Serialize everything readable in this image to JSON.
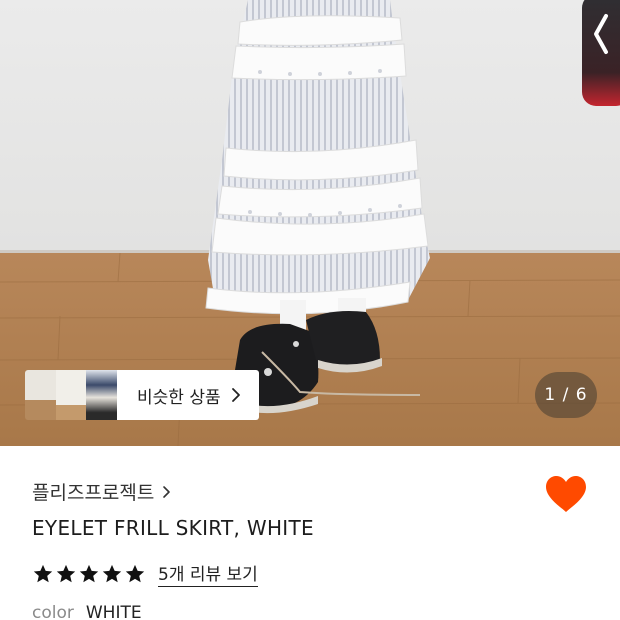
{
  "gallery": {
    "similar_label": "비슷한 상품",
    "counter": "1 / 6"
  },
  "product": {
    "brand": "플리즈프로젝트",
    "title": "EYELET FRILL SKIRT, WHITE",
    "rating_stars": 5,
    "review_link": "5개 리뷰 보기",
    "color_label": "color",
    "color_value": "WHITE",
    "wishlisted": true
  },
  "colors": {
    "heart": "#ff4a00",
    "side_tab_accent": "#c4252f"
  },
  "icons": [
    "chevron-left-icon",
    "chevron-right-icon",
    "star-icon",
    "heart-icon"
  ]
}
